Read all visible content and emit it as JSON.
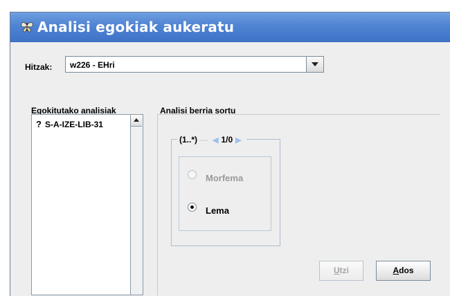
{
  "window": {
    "title": "Analisi egokiak aukeratu",
    "icon": "butterfly-app-icon"
  },
  "word_selector": {
    "label": "Hitzak:",
    "selected_value": "w226 - EHri",
    "arrow_icon": "chevron-down-icon"
  },
  "chosen_analyses": {
    "title": "Egokitutako analisiak",
    "items": [
      {
        "marker": "?",
        "label": "S-A-IZE-LIB-31"
      }
    ]
  },
  "new_analysis": {
    "title": "Analisi berria sortu",
    "group": {
      "cardinality": "(1..*)",
      "page": "1/0"
    },
    "options": [
      {
        "label": "Morfema",
        "selected": false,
        "enabled": false
      },
      {
        "label": "Lema",
        "selected": true,
        "enabled": true
      }
    ]
  },
  "buttons": {
    "cancel": {
      "mnemonic": "U",
      "rest": "tzi",
      "enabled": false
    },
    "next": {
      "mnemonic": "A",
      "rest": "dos",
      "enabled": true
    }
  },
  "colors": {
    "title_bar": "#4f83d3",
    "background": "#eeeeee"
  }
}
